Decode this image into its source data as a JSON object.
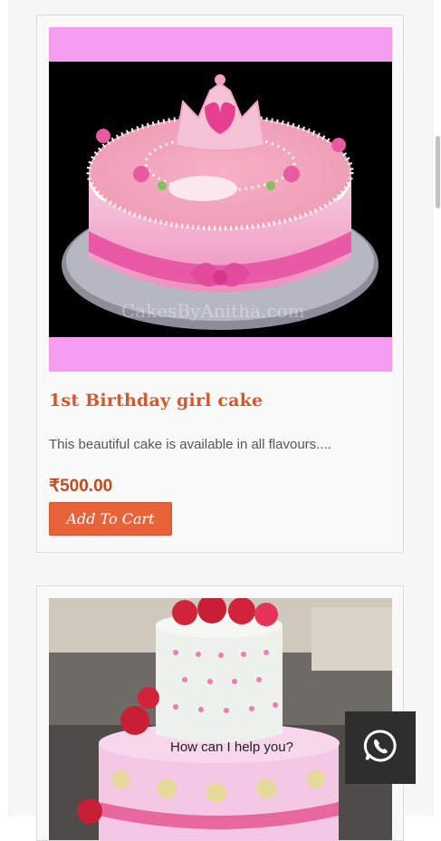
{
  "products": [
    {
      "title": "1st Birthday girl cake",
      "description": "This beautiful cake is available in all flavours....",
      "price": "₹500.00",
      "add_to_cart_label": "Add To Cart",
      "image_watermark": "CakesByAnitha.com"
    }
  ],
  "chat_widget": {
    "prompt": "How can I help you?",
    "icon": "whatsapp-icon"
  },
  "colors": {
    "title": "#d8562a",
    "price": "#c4491f",
    "button": "#e8633a",
    "image_band": "#f59bf0"
  }
}
